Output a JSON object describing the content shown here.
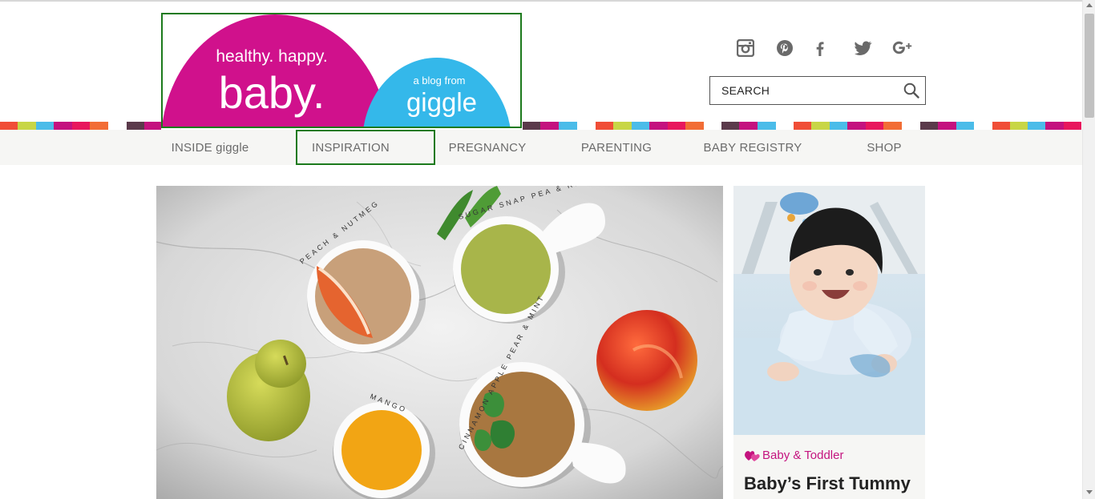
{
  "logo": {
    "tagline": "healthy. happy.",
    "wordmark": "baby.",
    "sub": "a blog from",
    "brand": "giggle"
  },
  "social": [
    {
      "icon": "instagram-icon"
    },
    {
      "icon": "pinterest-icon"
    },
    {
      "icon": "facebook-icon",
      "glyph": "f"
    },
    {
      "icon": "twitter-icon"
    },
    {
      "icon": "google-plus-icon",
      "glyph": "g+"
    }
  ],
  "search": {
    "placeholder": "SEARCH",
    "icon": "search-icon"
  },
  "nav": {
    "items": [
      {
        "label": "INSIDE giggle"
      },
      {
        "label": "INSPIRATION"
      },
      {
        "label": "PREGNANCY"
      },
      {
        "label": "PARENTING"
      },
      {
        "label": "BABY REGISTRY"
      },
      {
        "label": "SHOP"
      }
    ]
  },
  "hero": {
    "labels": {
      "bowl1": "PEACH & NUTMEG",
      "bowl2": "SUGAR SNAP PEA & RICE",
      "bowl3": "MANGO",
      "bowl4": "CINNAMON APPLE PEAR & MINT"
    }
  },
  "card": {
    "category": "Baby & Toddler",
    "category_icon": "hearts-icon",
    "title": "Baby’s First Tummy"
  },
  "colors": {
    "magenta": "#d0118c",
    "sky": "#34b8ea",
    "nav_bg": "#f6f6f4",
    "nav_text": "#6b6b6b",
    "category": "#c4137f",
    "highlight_border": "#1c7a1c"
  }
}
